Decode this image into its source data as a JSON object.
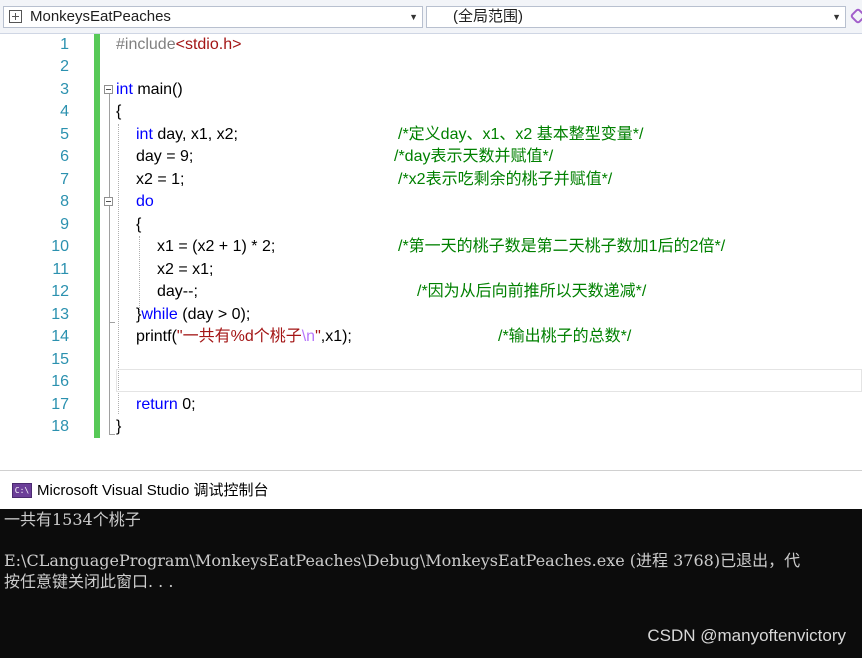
{
  "navbar": {
    "project": "MonkeysEatPeaches",
    "scope": "(全局范围)"
  },
  "editor": {
    "line_numbers": [
      "1",
      "2",
      "3",
      "4",
      "5",
      "6",
      "7",
      "8",
      "9",
      "10",
      "11",
      "12",
      "13",
      "14",
      "15",
      "16",
      "17",
      "18"
    ],
    "code": {
      "l1_include": "#include",
      "l1_header": "<stdio.h>",
      "l3_int": "int",
      "l3_main": " main()",
      "l4": "{",
      "l5_int": "int",
      "l5_rest": " day, x1, x2;",
      "l5_comment": "/*定义day、x1、x2 基本整型变量*/",
      "l6_code": "day = 9;",
      "l6_comment": "/*day表示天数并赋值*/",
      "l7_code": "x2 = 1;",
      "l7_comment": "/*x2表示吃剩余的桃子并赋值*/",
      "l8_do": "do",
      "l9": "{",
      "l10_code": "x1 = (x2 + 1) * 2;",
      "l10_comment": "/*第一天的桃子数是第二天桃子数加1后的2倍*/",
      "l11_code": "x2 = x1;",
      "l12_code": "day--;",
      "l12_comment": "/*因为从后向前推所以天数递减*/",
      "l13_brace": "}",
      "l13_while": "while",
      "l13_rest": " (day > 0);",
      "l14_printf": "printf(",
      "l14_str1": "\"一共有%d个桃子",
      "l14_esc": "\\n",
      "l14_str2": "\"",
      "l14_rest": ",x1);",
      "l14_comment": "/*输出桃子的总数*/",
      "l17_return": "return",
      "l17_rest": " 0;",
      "l18": "}"
    }
  },
  "console": {
    "title": "Microsoft Visual Studio 调试控制台",
    "icon_text": "C:\\",
    "output_line1": "一共有1534个桃子",
    "output_line2": "E:\\CLanguageProgram\\MonkeysEatPeaches\\Debug\\MonkeysEatPeaches.exe (进程 3768)已退出，代",
    "output_line3": "按任意键关闭此窗口. . ."
  },
  "watermark": "CSDN @manyoftenvictory"
}
